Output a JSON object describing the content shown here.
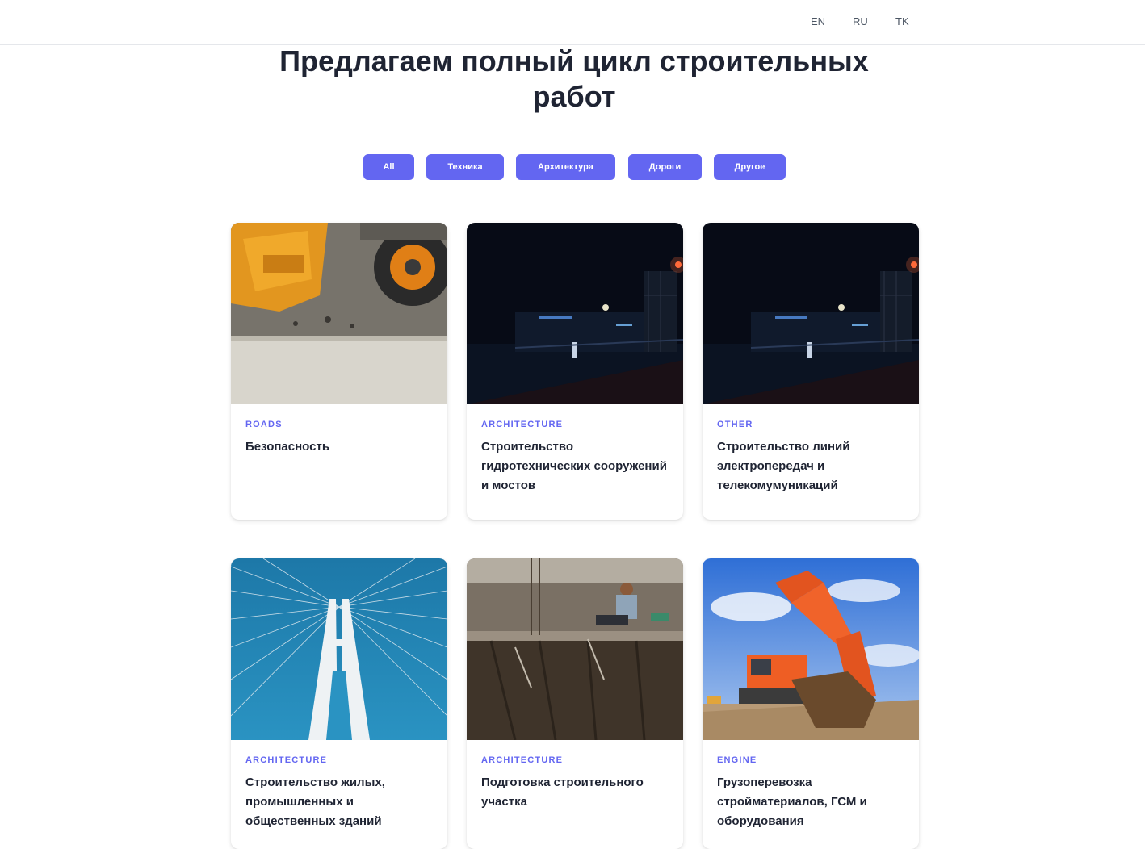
{
  "header": {
    "languages": [
      "EN",
      "RU",
      "TK"
    ]
  },
  "hero": {
    "title": "Предлагаем полный цикл строительных работ"
  },
  "filters": [
    "All",
    "Техника",
    "Архитектура",
    "Дороги",
    "Другое"
  ],
  "cards": [
    {
      "category": "ROADS",
      "title": "Безопасность",
      "image": "construction-machine-wheel-photo"
    },
    {
      "category": "ARCHITECTURE",
      "title": "Строительство гидротехнических сооружений и мостов",
      "image": "night-construction-site-photo"
    },
    {
      "category": "OTHER",
      "title": "Строительство линий электропередач и телекомумуникаций",
      "image": "night-construction-site-photo"
    },
    {
      "category": "ARCHITECTURE",
      "title": "Строительство жилых, промышленных и общественных зданий",
      "image": "cable-stayed-bridge-photo"
    },
    {
      "category": "ARCHITECTURE",
      "title": "Подготовка строительного участка",
      "image": "worker-on-formwork-photo"
    },
    {
      "category": "ENGINE",
      "title": "Грузоперевозка стройматериалов, ГСМ и оборудования",
      "image": "orange-excavator-photo"
    }
  ],
  "colors": {
    "accent": "#6366f1",
    "text": "#1f2433",
    "border": "#e5e7eb"
  }
}
